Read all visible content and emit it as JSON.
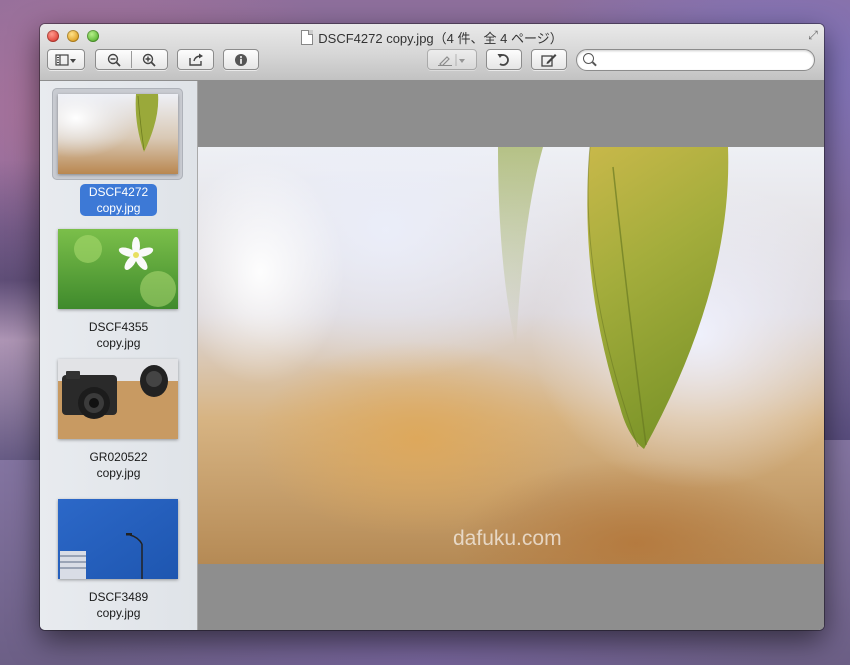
{
  "window": {
    "title": "DSCF4272 copy.jpg（4 件、全 4 ページ）"
  },
  "toolbar": {
    "view_menu_icon": "sidebar-icon",
    "zoom_out_icon": "zoom-out-icon",
    "zoom_in_icon": "zoom-in-icon",
    "share_icon": "share-icon",
    "info_icon": "info-icon",
    "markup_icon": "pen-icon",
    "rotate_icon": "rotate-icon",
    "edit_icon": "edit-icon"
  },
  "search": {
    "value": "",
    "placeholder": ""
  },
  "sidebar": {
    "items": [
      {
        "line1": "DSCF4272",
        "line2": "copy.jpg",
        "selected": true
      },
      {
        "line1": "DSCF4355",
        "line2": "copy.jpg",
        "selected": false
      },
      {
        "line1": "GR020522",
        "line2": "copy.jpg",
        "selected": false
      },
      {
        "line1": "DSCF3489",
        "line2": "copy.jpg",
        "selected": false
      }
    ]
  },
  "viewer": {
    "watermark": "dafuku.com"
  },
  "colors": {
    "selection": "#3d79d6",
    "sidebar_bg": "#e3e6ea",
    "viewer_bg": "#8e8e8e"
  }
}
